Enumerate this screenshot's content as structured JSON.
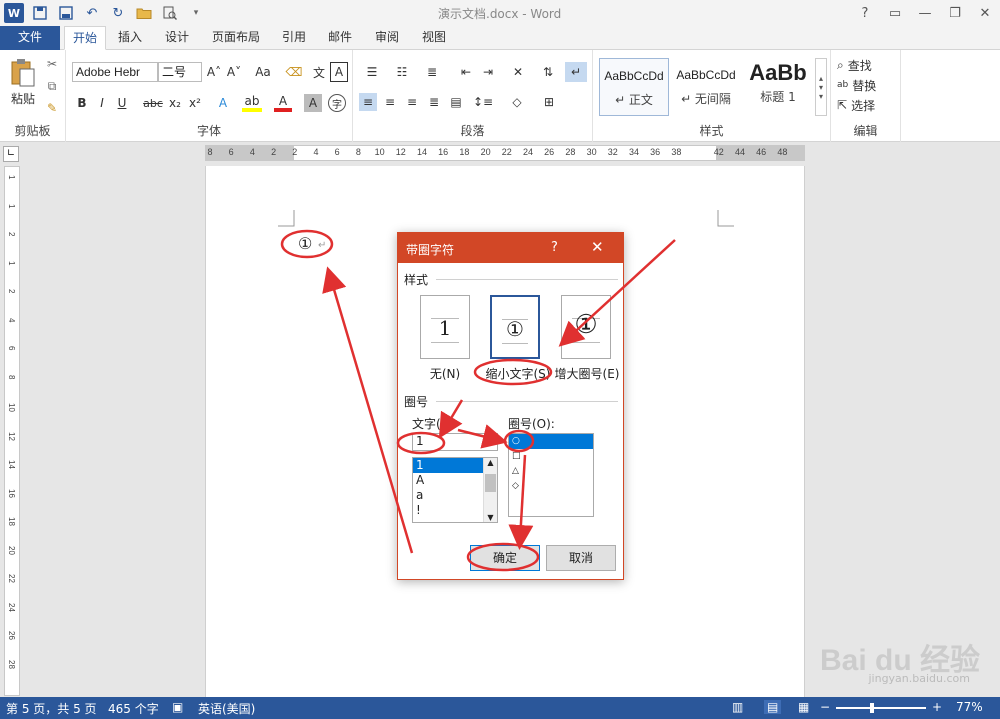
{
  "window": {
    "title": "演示文档.docx - Word",
    "controls": [
      "?",
      "▭",
      "—",
      "❐",
      "✕"
    ]
  },
  "qat": {
    "app_icon": "W",
    "save_icon": "save-icon",
    "undo_icon": "undo-icon",
    "redo_icon": "redo-icon",
    "open_icon": "open-folder-icon",
    "preview_icon": "print-preview-icon"
  },
  "tabs": [
    "文件",
    "开始",
    "插入",
    "设计",
    "页面布局",
    "引用",
    "邮件",
    "审阅",
    "视图"
  ],
  "ribbon": {
    "clipboard": {
      "paste_label": "粘贴",
      "group_label": "剪贴板"
    },
    "font": {
      "font_name": "Adobe Hebr",
      "font_size": "二号",
      "group_label": "字体",
      "grow": "A˄",
      "shrink": "A˅",
      "case": "Aa",
      "bold": "B",
      "italic": "I",
      "underline": "U",
      "strike": "abc",
      "sub": "x₂",
      "sup": "x²"
    },
    "paragraph": {
      "group_label": "段落"
    },
    "styles": {
      "group_label": "样式",
      "items": [
        {
          "preview": "AaBbCcDd",
          "name": "↵ 正文"
        },
        {
          "preview": "AaBbCcDd",
          "name": "↵ 无间隔"
        },
        {
          "preview": "AaBb",
          "name": "标题 1"
        }
      ]
    },
    "editing": {
      "find": "查找",
      "replace": "替换",
      "select": "选择",
      "group_label": "编辑"
    }
  },
  "ruler": {
    "h_numbers": [
      "8",
      "6",
      "4",
      "2",
      "2",
      "4",
      "6",
      "8",
      "10",
      "12",
      "14",
      "16",
      "18",
      "20",
      "22",
      "24",
      "26",
      "28",
      "30",
      "32",
      "34",
      "36",
      "38",
      "42",
      "44",
      "46",
      "48"
    ],
    "v_numbers": [
      "1",
      "1",
      "2",
      "1",
      "2",
      "4",
      "6",
      "8",
      "10",
      "12",
      "14",
      "16",
      "18",
      "20",
      "22",
      "24",
      "26",
      "28"
    ]
  },
  "document": {
    "char": "①",
    "mark": "↵"
  },
  "dialog": {
    "title": "带圈字符",
    "help": "?",
    "close": "✕",
    "style_section": "样式",
    "styles": [
      {
        "label": "无(N)",
        "glyph": "1"
      },
      {
        "label": "缩小文字(S)",
        "glyph": "①"
      },
      {
        "label": "增大圈号(E)",
        "glyph": "①"
      }
    ],
    "enclosure_section": "圈号",
    "text_label": "文字(T):",
    "text_value": "1",
    "text_list": [
      "1",
      "A",
      "a",
      "!"
    ],
    "enclosure_label": "圈号(O):",
    "enclosure_list": [
      "○",
      "□",
      "△",
      "◇"
    ],
    "ok": "确定",
    "cancel": "取消"
  },
  "status": {
    "page": "第 5 页，共 5 页",
    "words": "465 个字",
    "language": "英语(美国)",
    "zoom": "77%"
  },
  "watermark": {
    "brand": "Bai du 经验",
    "url": "jingyan.baidu.com"
  },
  "colors": {
    "word_blue": "#2b579a",
    "dialog_orange": "#d24726",
    "annotation_red": "#e03030",
    "selection_blue": "#0078d7"
  }
}
